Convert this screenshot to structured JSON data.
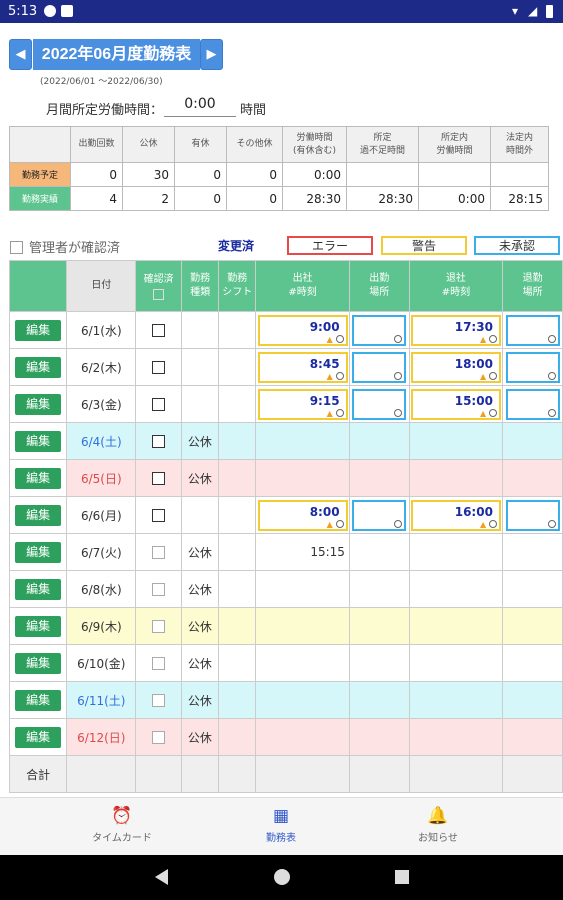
{
  "status_bar": {
    "time": "5:13"
  },
  "header": {
    "prev_icon": "arrow-left-icon",
    "next_icon": "arrow-right-icon",
    "prev_glyph": "◀",
    "next_glyph": "▶",
    "title": "2022年06月度勤務表",
    "range": "(2022/06/01 ～2022/06/30)",
    "required_hours_label": "月間所定労働時間：",
    "required_hours_value": "0:00",
    "required_hours_unit": "時間"
  },
  "summary": {
    "headers": [
      "出勤回数",
      "公休",
      "有休",
      "その他休",
      "労働時間\n(有休含む)",
      "所定\n過不足時間",
      "所定内\n労働時間",
      "法定内\n時間外"
    ],
    "rows": [
      {
        "label": "勤務予定",
        "values": [
          "0",
          "30",
          "0",
          "0",
          "0:00",
          "",
          "",
          ""
        ]
      },
      {
        "label": "勤務実績",
        "values": [
          "4",
          "2",
          "0",
          "0",
          "28:30",
          "28:30",
          "0:00",
          "28:15"
        ]
      }
    ]
  },
  "confirm_label": "管理者が確認済",
  "legend": [
    {
      "label": "変更済",
      "border": "#ffffff",
      "color": "#1a2aa0"
    },
    {
      "label": "エラー",
      "border": "#e84a4a",
      "color": "#333333"
    },
    {
      "label": "警告",
      "border": "#f2cc33",
      "color": "#333333"
    },
    {
      "label": "未承認",
      "border": "#3aaee8",
      "color": "#333333"
    }
  ],
  "attendance": {
    "headers": [
      "日付",
      "確認済",
      "勤務\n種類",
      "勤務\nシフト",
      "出社\n#時刻",
      "出勤\n場所",
      "退社\n#時刻",
      "退勤\n場所"
    ],
    "edit_label": "編集",
    "rows": [
      {
        "date": "6/1(水)",
        "day": "weekday",
        "bg": "#ffffff",
        "confirmed": false,
        "kind": "",
        "in": "9:00",
        "out": "17:30",
        "boxes": true
      },
      {
        "date": "6/2(木)",
        "day": "weekday",
        "bg": "#ffffff",
        "confirmed": false,
        "kind": "",
        "in": "8:45",
        "out": "18:00",
        "boxes": true
      },
      {
        "date": "6/3(金)",
        "day": "weekday",
        "bg": "#ffffff",
        "confirmed": false,
        "kind": "",
        "in": "9:15",
        "out": "15:00",
        "boxes": true
      },
      {
        "date": "6/4(土)",
        "day": "sat",
        "bg": "#d6f7fa",
        "confirmed": false,
        "kind": "公休",
        "in": "",
        "out": "",
        "boxes": false
      },
      {
        "date": "6/5(日)",
        "day": "sun",
        "bg": "#fde3e3",
        "confirmed": false,
        "kind": "公休",
        "in": "",
        "out": "",
        "boxes": false
      },
      {
        "date": "6/6(月)",
        "day": "weekday",
        "bg": "#ffffff",
        "confirmed": false,
        "kind": "",
        "in": "8:00",
        "out": "16:00",
        "boxes": true
      },
      {
        "date": "6/7(火)",
        "day": "weekday",
        "bg": "#ffffff",
        "confirmed": false,
        "dim": true,
        "kind": "公休",
        "in": "15:15",
        "out": "",
        "boxes": false
      },
      {
        "date": "6/8(水)",
        "day": "weekday",
        "bg": "#ffffff",
        "confirmed": false,
        "dim": true,
        "kind": "公休",
        "in": "",
        "out": "",
        "boxes": false
      },
      {
        "date": "6/9(木)",
        "day": "weekday",
        "bg": "#fdfbd0",
        "confirmed": false,
        "dim": true,
        "kind": "公休",
        "in": "",
        "out": "",
        "boxes": false
      },
      {
        "date": "6/10(金)",
        "day": "weekday",
        "bg": "#ffffff",
        "confirmed": false,
        "dim": true,
        "kind": "公休",
        "in": "",
        "out": "",
        "boxes": false
      },
      {
        "date": "6/11(土)",
        "day": "sat",
        "bg": "#d6f7fa",
        "confirmed": false,
        "dim": true,
        "kind": "公休",
        "in": "",
        "out": "",
        "boxes": false
      },
      {
        "date": "6/12(日)",
        "day": "sun",
        "bg": "#fde3e3",
        "confirmed": false,
        "dim": true,
        "kind": "公休",
        "in": "",
        "out": "",
        "boxes": false
      }
    ],
    "total_label": "合計"
  },
  "colors": {
    "accent_green": "#5ec48f",
    "edit_green": "#2ea05e",
    "header_blue": "#4a8fe0",
    "sat": "#2f6fe0",
    "sun": "#e04848"
  },
  "tabs": [
    {
      "label": "タイムカード",
      "icon": "alarm-clock-icon",
      "glyph": "⏰"
    },
    {
      "label": "勤務表",
      "icon": "calendar-icon",
      "glyph": "▦"
    },
    {
      "label": "お知らせ",
      "icon": "bell-icon",
      "glyph": "🔔"
    }
  ]
}
